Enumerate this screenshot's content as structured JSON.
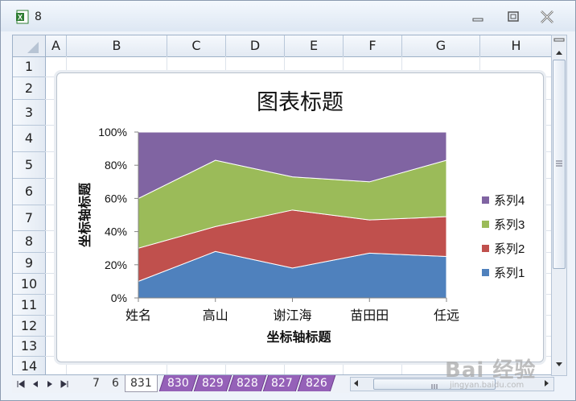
{
  "window": {
    "title": "8"
  },
  "sheet": {
    "columns": [
      "A",
      "B",
      "C",
      "D",
      "E",
      "F",
      "G",
      "H"
    ],
    "rows": [
      "1",
      "2",
      "3",
      "4",
      "5",
      "6",
      "7",
      "8",
      "9",
      "10",
      "11",
      "12",
      "13",
      "14"
    ]
  },
  "tabs": {
    "items": [
      "7",
      "6",
      "831",
      "830",
      "829",
      "828",
      "827",
      "826"
    ],
    "active": "831"
  },
  "watermark": {
    "logo": "Bai 经验",
    "url": "jingyan.baidu.com"
  },
  "colors": {
    "series1": "#4f81bd",
    "series2": "#c0504d",
    "series3": "#9bbb59",
    "series4": "#8064a2"
  },
  "chart_data": {
    "type": "area",
    "stacked": "percent",
    "title": "图表标题",
    "xlabel": "坐标轴标题",
    "ylabel": "坐标轴标题",
    "categories": [
      "姓名",
      "高山",
      "谢江海",
      "苗田田",
      "任远"
    ],
    "yticks": [
      "0%",
      "20%",
      "40%",
      "60%",
      "80%",
      "100%"
    ],
    "ylim": [
      0,
      100
    ],
    "series": [
      {
        "name": "系列1",
        "values": [
          10,
          28,
          18,
          27,
          25
        ]
      },
      {
        "name": "系列2",
        "values": [
          20,
          15,
          35,
          20,
          24
        ]
      },
      {
        "name": "系列3",
        "values": [
          30,
          40,
          20,
          23,
          34
        ]
      },
      {
        "name": "系列4",
        "values": [
          40,
          17,
          27,
          30,
          17
        ]
      }
    ],
    "legend_position": "right"
  }
}
